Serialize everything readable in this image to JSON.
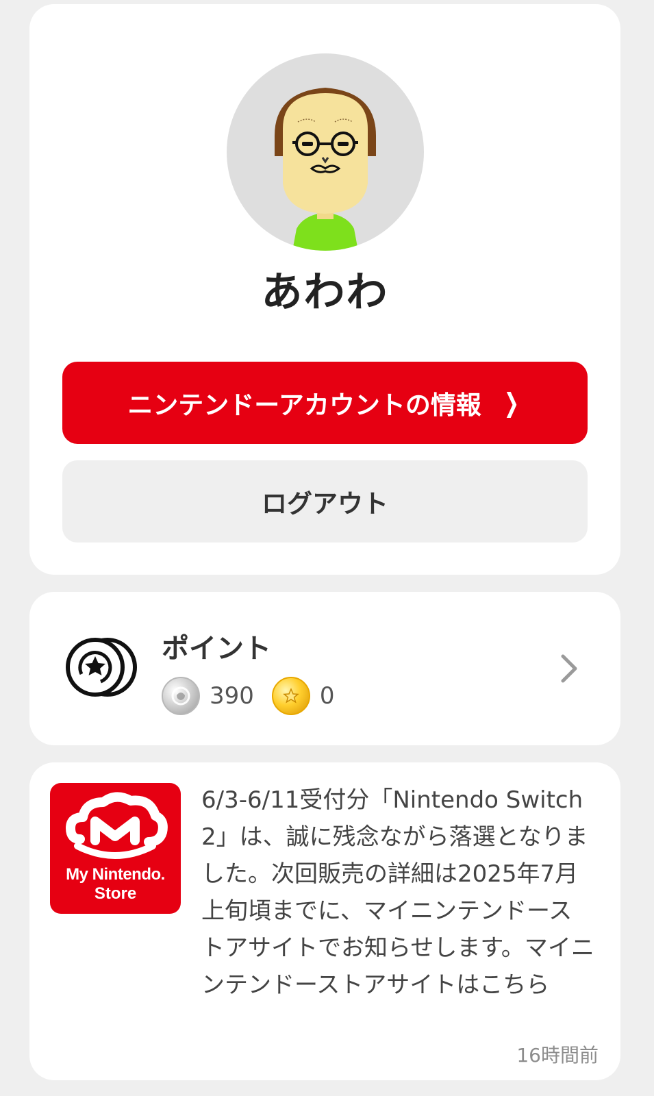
{
  "profile": {
    "username": "あわわ",
    "account_button_label": "ニンテンドーアカウントの情報",
    "logout_button_label": "ログアウト"
  },
  "points": {
    "title": "ポイント",
    "platinum_points": "390",
    "gold_points": "0"
  },
  "news": {
    "store_logo_line1": "My Nintendo.",
    "store_logo_line2": "Store",
    "message": "6/3-6/11受付分「Nintendo Switch 2」は、誠に残念ながら落選となりました。次回販売の詳細は2025年7月上旬頃までに、マイニンテンドーストアサイトでお知らせします。マイニンテンドーストアサイトはこちら",
    "time": "16時間前"
  },
  "colors": {
    "brand_red": "#e60012",
    "background": "#efefef",
    "card": "#ffffff"
  },
  "icons": {
    "account_chevron": "chevron-right-icon",
    "points_icon": "coins-star-icon",
    "points_arrow": "chevron-right-icon",
    "platinum_coin": "platinum-coin-icon",
    "gold_coin": "gold-coin-icon"
  }
}
